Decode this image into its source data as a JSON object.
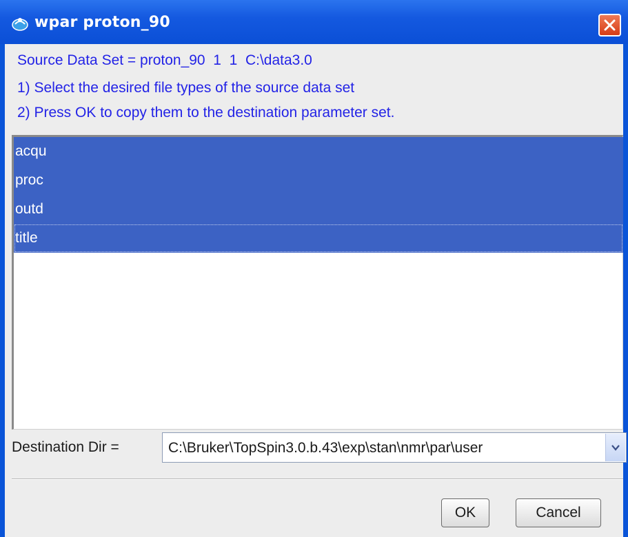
{
  "window": {
    "title": "wpar proton_90",
    "close_icon": "close-icon",
    "app_icon": "topspin-app-icon"
  },
  "info": {
    "line1": "Source Data Set = proton_90  1  1  C:\\data3.0",
    "line2": "1) Select the desired file types of the source data set",
    "line3": "2) Press OK to copy them to the destination parameter set."
  },
  "file_types": {
    "items": [
      {
        "label": "acqu",
        "selected": true
      },
      {
        "label": "proc",
        "selected": true
      },
      {
        "label": "outd",
        "selected": true
      },
      {
        "label": "title",
        "selected": true
      }
    ]
  },
  "destination": {
    "label": "Destination Dir =",
    "value": "C:\\Bruker\\TopSpin3.0.b.43\\exp\\stan\\nmr\\par\\user",
    "dropdown_icon": "chevron-down-icon"
  },
  "buttons": {
    "ok": "OK",
    "cancel": "Cancel"
  },
  "colors": {
    "titlebar": "#0a54d8",
    "info_text": "#2323e6",
    "selection": "#3c62c4",
    "close_button": "#e0562f"
  }
}
